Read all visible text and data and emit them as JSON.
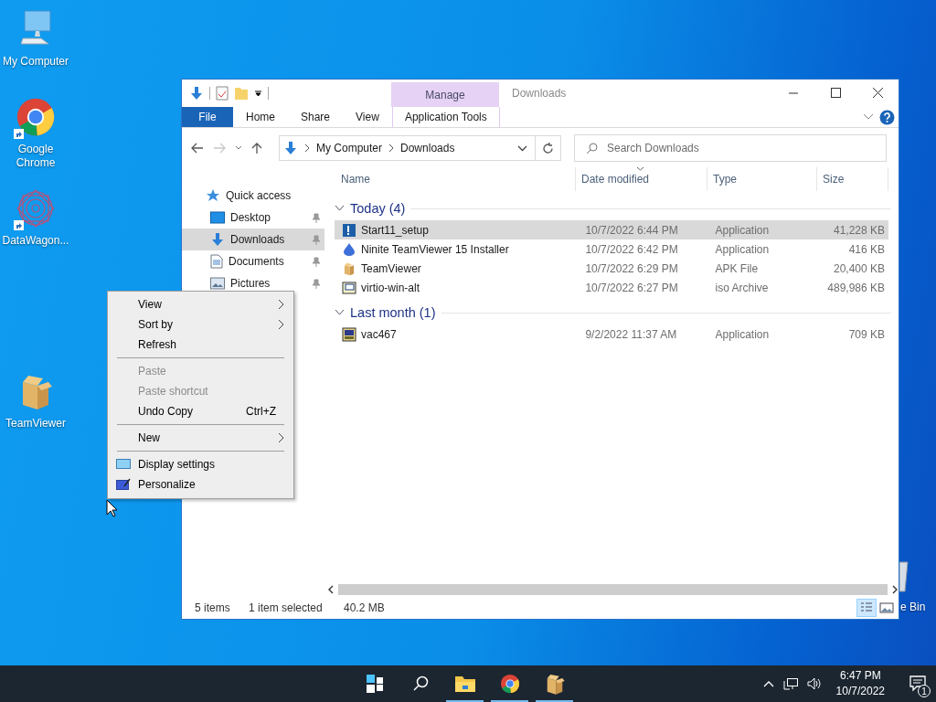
{
  "desktop": {
    "icons": [
      {
        "label": "My Computer",
        "shortcut": false
      },
      {
        "label": "Google Chrome",
        "shortcut": true
      },
      {
        "label": "DataWagon...",
        "shortcut": true
      },
      {
        "label": "TeamViewer",
        "shortcut": false
      },
      {
        "label": "e Bin",
        "shortcut": false
      }
    ]
  },
  "window": {
    "title": "Downloads",
    "ribbon": {
      "file_button": "File",
      "contextual_group": "Manage",
      "tabs": [
        {
          "label": "Home",
          "selected": false
        },
        {
          "label": "Share",
          "selected": false
        },
        {
          "label": "View",
          "selected": false
        },
        {
          "label": "Application Tools",
          "selected": false
        }
      ]
    },
    "address": {
      "path": [
        "My Computer",
        "Downloads"
      ]
    },
    "search": {
      "placeholder": "Search Downloads"
    },
    "navigation": [
      {
        "label": "Quick access",
        "selected": false
      },
      {
        "label": "Desktop",
        "selected": false,
        "pinned": true
      },
      {
        "label": "Downloads",
        "selected": true,
        "pinned": true
      },
      {
        "label": "Documents",
        "selected": false,
        "pinned": true
      },
      {
        "label": "Pictures",
        "selected": false,
        "pinned": true
      }
    ],
    "columns": [
      {
        "label": "Name",
        "sorted": false
      },
      {
        "label": "Date modified",
        "sorted": true
      },
      {
        "label": "Type",
        "sorted": false
      },
      {
        "label": "Size",
        "sorted": false
      }
    ],
    "file_groups": [
      {
        "label": "Today (4)",
        "expanded": true,
        "files": [
          {
            "name": "Start11_setup",
            "date": "10/7/2022 6:44 PM",
            "type": "Application",
            "size": "41,228 KB",
            "selected": true
          },
          {
            "name": "Ninite TeamViewer 15 Installer",
            "date": "10/7/2022 6:42 PM",
            "type": "Application",
            "size": "416 KB",
            "selected": false
          },
          {
            "name": "TeamViewer",
            "date": "10/7/2022 6:29 PM",
            "type": "APK File",
            "size": "20,400 KB",
            "selected": false
          },
          {
            "name": "virtio-win-alt",
            "date": "10/7/2022 6:27 PM",
            "type": "iso Archive",
            "size": "489,986 KB",
            "selected": false
          }
        ]
      },
      {
        "label": "Last month (1)",
        "expanded": true,
        "files": [
          {
            "name": "vac467",
            "date": "9/2/2022 11:37 AM",
            "type": "Application",
            "size": "709 KB",
            "selected": false
          }
        ]
      }
    ],
    "status_bar": {
      "item_count": "5 items",
      "selection": "1 item selected",
      "selection_size": "40.2 MB"
    }
  },
  "context_menu": {
    "items": [
      {
        "kind": "item",
        "label": "View",
        "submenu": true,
        "disabled": false
      },
      {
        "kind": "item",
        "label": "Sort by",
        "submenu": true,
        "disabled": false
      },
      {
        "kind": "item",
        "label": "Refresh",
        "submenu": false,
        "disabled": false
      },
      {
        "kind": "separator"
      },
      {
        "kind": "item",
        "label": "Paste",
        "submenu": false,
        "disabled": true
      },
      {
        "kind": "item",
        "label": "Paste shortcut",
        "submenu": false,
        "disabled": true
      },
      {
        "kind": "item",
        "label": "Undo Copy",
        "shortcut": "Ctrl+Z",
        "submenu": false,
        "disabled": false
      },
      {
        "kind": "separator"
      },
      {
        "kind": "item",
        "label": "New",
        "submenu": true,
        "disabled": false
      },
      {
        "kind": "separator"
      },
      {
        "kind": "item",
        "label": "Display settings",
        "submenu": false,
        "disabled": false
      },
      {
        "kind": "item",
        "label": "Personalize",
        "submenu": false,
        "disabled": false
      }
    ]
  },
  "taskbar": {
    "apps": [
      {
        "running": false
      },
      {
        "running": false
      },
      {
        "running": true
      },
      {
        "running": true
      },
      {
        "running": true
      }
    ],
    "time": "6:47 PM",
    "date": "10/7/2022",
    "notification_count": "1"
  }
}
